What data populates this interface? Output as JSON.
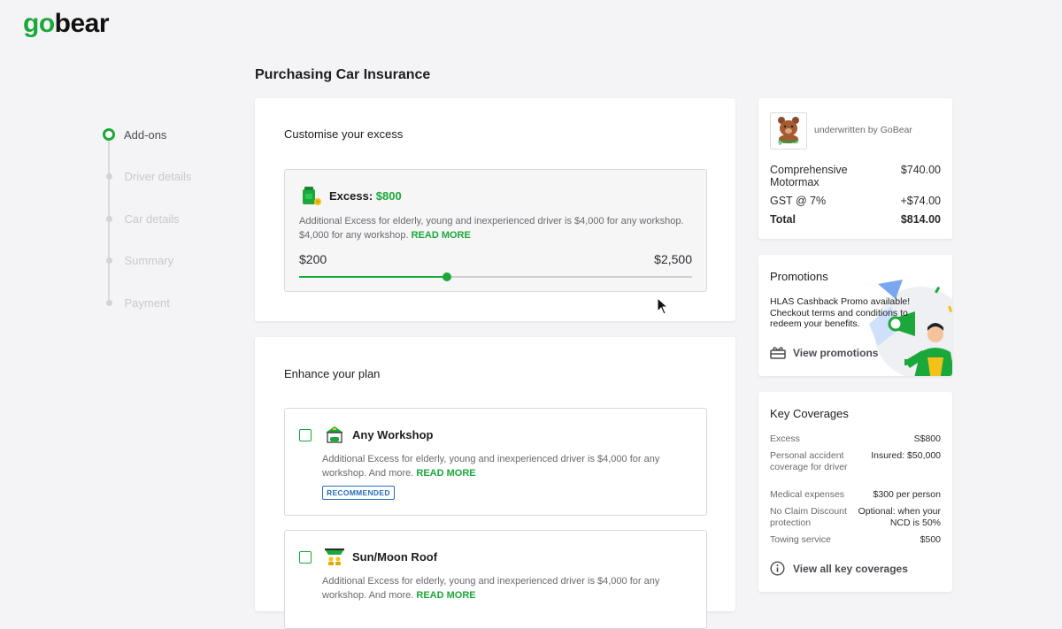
{
  "brand": {
    "logo_go": "go",
    "logo_bear": "bear",
    "accent_color": "#1ba83a"
  },
  "page": {
    "title": "Purchasing Car Insurance"
  },
  "stepper": {
    "steps": [
      {
        "label": "Add-ons",
        "active": true
      },
      {
        "label": "Driver details",
        "active": false
      },
      {
        "label": "Car details",
        "active": false
      },
      {
        "label": "Summary",
        "active": false
      },
      {
        "label": "Payment",
        "active": false
      }
    ]
  },
  "excess": {
    "heading": "Customise your excess",
    "title_prefix": "Excess:",
    "amount": "$800",
    "description": "Additional Excess for elderly, young and inexperienced driver is $4,000 for any workshop. $4,000 for any workshop.",
    "read_more": "READ MORE",
    "range_min": "$200",
    "range_max": "$2,500",
    "slider_fraction": 0.375
  },
  "plan": {
    "heading": "Enhance your plan",
    "addons": [
      {
        "name": "Any Workshop",
        "description": "Additional Excess for elderly, young and inexperienced driver is $4,000 for any workshop. And more.",
        "read_more": "READ MORE",
        "badge": "RECOMMENDED",
        "checked": false
      },
      {
        "name": "Sun/Moon Roof",
        "description": "Additional Excess for elderly, young and inexperienced driver is $4,000 for any workshop. And more.",
        "read_more": "READ MORE",
        "checked": false
      }
    ]
  },
  "summary": {
    "underwritten": "underwritten by GoBear",
    "bear_label": "gobear",
    "rows": [
      {
        "label": "Comprehensive Motormax",
        "value": "$740.00"
      },
      {
        "label": "GST @ 7%",
        "value": "+$74.00"
      },
      {
        "label": "Total",
        "value": "$814.00"
      }
    ]
  },
  "promotions": {
    "title": "Promotions",
    "description": "HLAS Cashback Promo available! Checkout terms and conditions to redeem your benefits.",
    "link": "View promotions"
  },
  "key_coverages": {
    "title": "Key Coverages",
    "rows": [
      {
        "label": "Excess",
        "value": "S$800"
      },
      {
        "label": "Personal accident coverage for driver",
        "value": "Insured: $50,000"
      },
      {
        "label": "Medical expenses",
        "value": "$300 per person"
      },
      {
        "label": "No Claim Discount protection",
        "value": "Optional: when your NCD is 50%"
      },
      {
        "label": "Towing service",
        "value": "$500"
      }
    ],
    "link": "View all key coverages"
  }
}
